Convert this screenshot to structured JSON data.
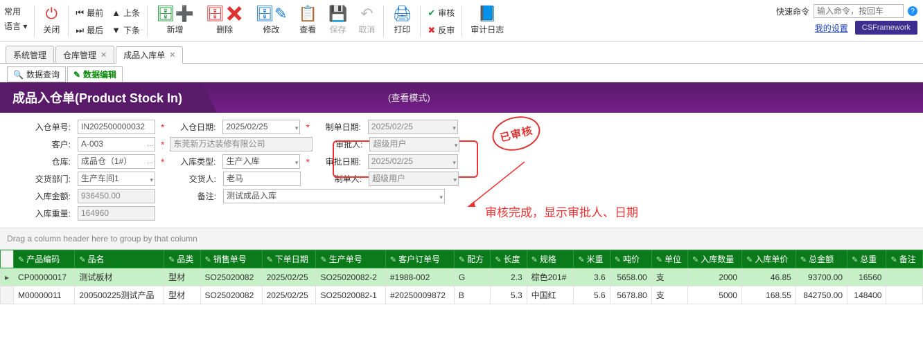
{
  "toolbar": {
    "left_col": {
      "lang": "语言 ▾",
      "common": "常用"
    },
    "close": "关闭",
    "first": "最前",
    "last": "最后",
    "prev": "上条",
    "next": "下条",
    "add": "新增",
    "delete": "删除",
    "modify": "修改",
    "view": "查看",
    "save": "保存",
    "cancel": "取消",
    "print": "打印",
    "audit": "审核",
    "unaudit": "反审",
    "auditlog": "审计日志"
  },
  "quick": {
    "label": "快速命令",
    "placeholder": "输入命令，按回车"
  },
  "links": {
    "mysettings": "我的设置",
    "framework": "CSFramework"
  },
  "main_tabs": [
    {
      "label": "系统管理",
      "active": false,
      "closable": false
    },
    {
      "label": "仓库管理",
      "active": false,
      "closable": true
    },
    {
      "label": "成品入库单",
      "active": true,
      "closable": true
    }
  ],
  "sub_tabs": [
    {
      "label": "数据查询",
      "active": false,
      "icon": "🔍"
    },
    {
      "label": "数据编辑",
      "active": true,
      "icon": "✎"
    }
  ],
  "section": {
    "title": "成品入仓单(Product Stock In)",
    "mode": "(查看模式)"
  },
  "form": {
    "doc_no_label": "入仓单号:",
    "doc_no": "IN202500000032",
    "date_label": "入仓日期:",
    "date": "2025/02/25",
    "create_date_label": "制单日期:",
    "create_date": "2025/02/25",
    "cust_label": "客户:",
    "cust_code": "A-003",
    "cust_name": "东莞新万达装修有限公司",
    "approver_label": "审批人:",
    "approver": "超级用户",
    "wh_label": "仓库:",
    "wh": "成品仓（1#）",
    "in_type_label": "入库类型:",
    "in_type": "生产入库",
    "approve_date_label": "审批日期:",
    "approve_date": "2025/02/25",
    "dept_label": "交货部门:",
    "dept": "生产车间1",
    "deliverer_label": "交货人:",
    "deliverer": "老马",
    "creator_label": "制单人:",
    "creator": "超级用户",
    "amt_label": "入库金额:",
    "amt": "936450.00",
    "remark_label": "备注:",
    "remark": "测试成品入库",
    "wt_label": "入库重量:",
    "wt": "164960"
  },
  "stamp": "已审核",
  "annotation": "审核完成，显示审批人、日期",
  "grid_group_hint": "Drag a column header here to group by that column",
  "columns": [
    "产品编码",
    "品名",
    "品类",
    "销售单号",
    "下单日期",
    "生产单号",
    "客户订单号",
    "配方",
    "长度",
    "规格",
    "米重",
    "吨价",
    "单位",
    "入库数量",
    "入库单价",
    "总金额",
    "总重",
    "备注"
  ],
  "chart_data": {
    "type": "table",
    "columns": [
      "产品编码",
      "品名",
      "品类",
      "销售单号",
      "下单日期",
      "生产单号",
      "客户订单号",
      "配方",
      "长度",
      "规格",
      "米重",
      "吨价",
      "单位",
      "入库数量",
      "入库单价",
      "总金额",
      "总重",
      "备注"
    ],
    "rows": [
      {
        "产品编码": "CP00000017",
        "品名": "测试板材",
        "品类": "型材",
        "销售单号": "SO25020082",
        "下单日期": "2025/02/25",
        "生产单号": "SO25020082-2",
        "客户订单号": "#1988-002",
        "配方": "G",
        "长度": 2.3,
        "规格": "棕色201#",
        "米重": 3.6,
        "吨价": 5658.0,
        "单位": "支",
        "入库数量": 2000,
        "入库单价": 46.85,
        "总金额": 93700.0,
        "总重": 16560,
        "备注": ""
      },
      {
        "产品编码": "M00000011",
        "品名": "200500225测试产品",
        "品类": "型材",
        "销售单号": "SO25020082",
        "下单日期": "2025/02/25",
        "生产单号": "SO25020082-1",
        "客户订单号": "#20250009872",
        "配方": "B",
        "长度": 5.3,
        "规格": "中国红",
        "米重": 5.6,
        "吨价": 5678.8,
        "单位": "支",
        "入库数量": 5000,
        "入库单价": 168.55,
        "总金额": 842750.0,
        "总重": 148400,
        "备注": ""
      }
    ]
  }
}
